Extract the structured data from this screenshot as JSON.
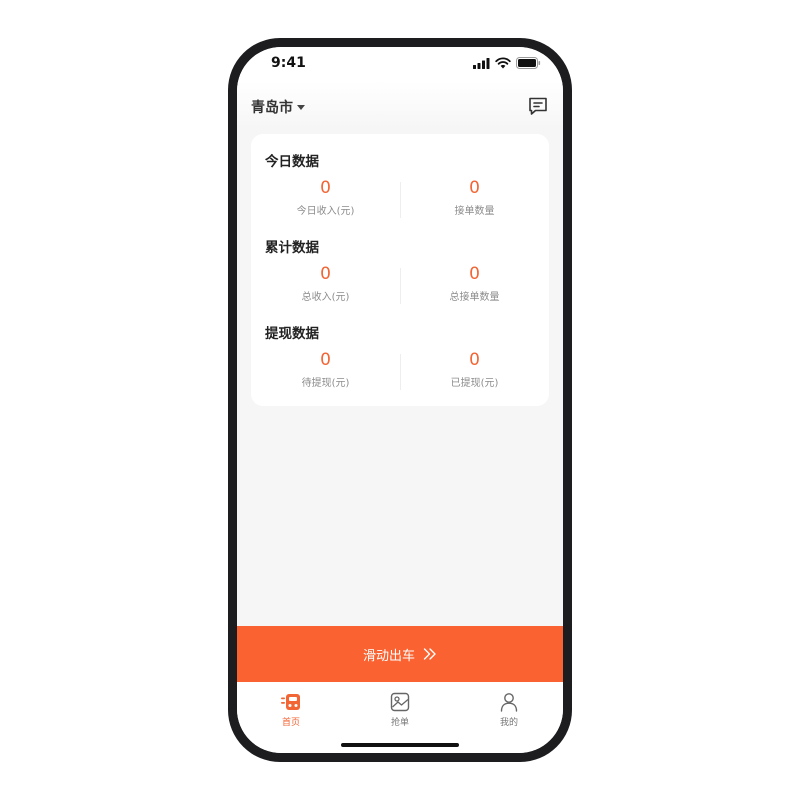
{
  "status_bar": {
    "time": "9:41"
  },
  "header": {
    "city": "青岛市",
    "message_icon": "message-icon"
  },
  "sections": [
    {
      "title": "今日数据",
      "stats": [
        {
          "value": "0",
          "label": "今日收入(元)"
        },
        {
          "value": "0",
          "label": "接单数量"
        }
      ]
    },
    {
      "title": "累计数据",
      "stats": [
        {
          "value": "0",
          "label": "总收入(元)"
        },
        {
          "value": "0",
          "label": "总接单数量"
        }
      ]
    },
    {
      "title": "提现数据",
      "stats": [
        {
          "value": "0",
          "label": "待提现(元)"
        },
        {
          "value": "0",
          "label": "已提现(元)"
        }
      ]
    }
  ],
  "depart_button": {
    "label": "滑动出车",
    "icon": "double-chevron-right-icon"
  },
  "tabbar": {
    "items": [
      {
        "label": "首页",
        "icon": "car-icon",
        "active": true
      },
      {
        "label": "抢单",
        "icon": "grab-order-icon",
        "active": false
      },
      {
        "label": "我的",
        "icon": "user-icon",
        "active": false
      }
    ]
  },
  "colors": {
    "accent": "#fa6331",
    "value_text": "#f26535",
    "background": "#f6f6f6"
  }
}
